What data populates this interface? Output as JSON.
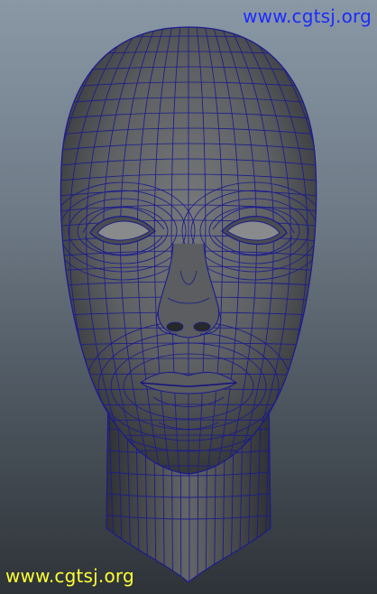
{
  "watermark_top": {
    "text": "www.cgtsj.org",
    "color": "#1a2cff"
  },
  "watermark_bottom": {
    "text": "www.cgtsj.org",
    "color": "#ffff33"
  },
  "colors": {
    "wire": "#1c1c8c",
    "skin_light": "#6e6f70",
    "skin_mid": "#55575a",
    "skin_dark": "#2f3133",
    "bg_top": "#8a98a6",
    "bg_bottom": "#2e3338"
  },
  "subject": "3d-head-wireframe-model"
}
